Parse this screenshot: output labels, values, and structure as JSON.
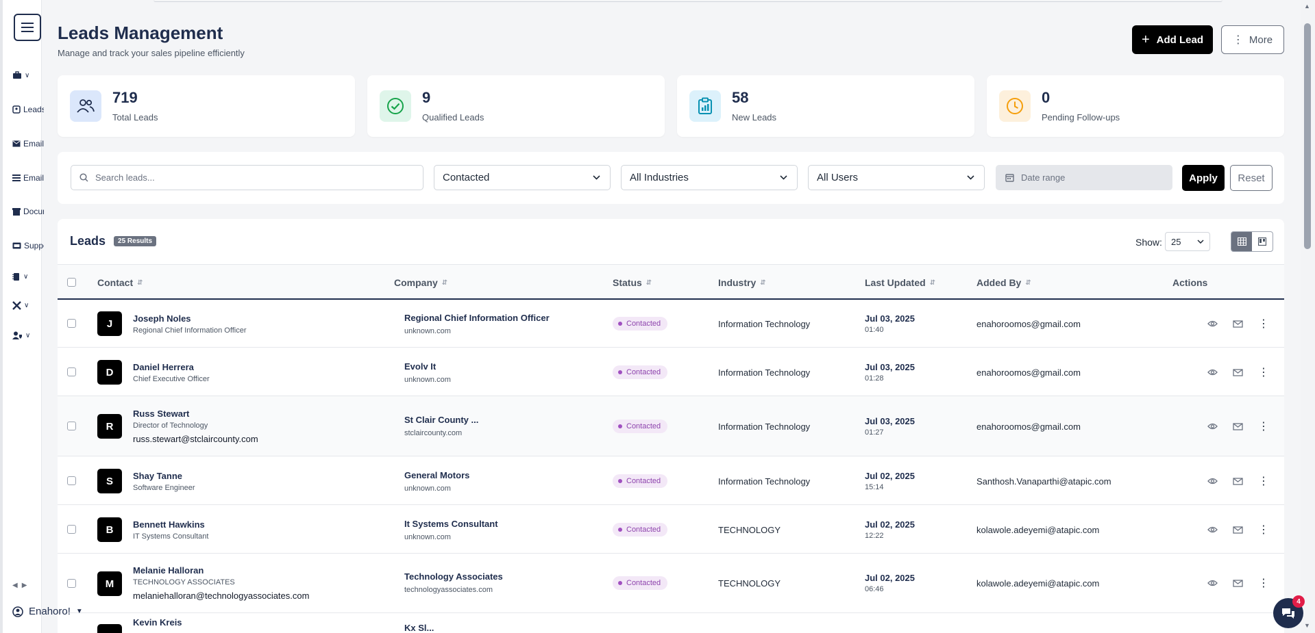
{
  "page": {
    "title": "Leads Management",
    "subtitle": "Manage and track your sales pipeline efficiently",
    "add_lead": "Add Lead",
    "more": "More"
  },
  "sidebar": {
    "items": [
      {
        "label": "",
        "icon": "briefcase-icon"
      },
      {
        "label": "Leads",
        "icon": "contact-card-icon"
      },
      {
        "label": "Email",
        "icon": "envelope-icon"
      },
      {
        "label": "Email",
        "icon": "list-icon"
      },
      {
        "label": "Documents",
        "icon": "archive-icon"
      },
      {
        "label": "Support",
        "icon": "ticket-icon"
      },
      {
        "label": "",
        "icon": "chip-icon"
      },
      {
        "label": "",
        "icon": "tools-icon"
      },
      {
        "label": "",
        "icon": "user-shield-icon"
      }
    ],
    "user": "Enahoro!"
  },
  "stats": [
    {
      "value": "719",
      "label": "Total Leads",
      "icon": "users-icon",
      "bg": "#dbe7fb",
      "fg": "#1f2d4d"
    },
    {
      "value": "9",
      "label": "Qualified Leads",
      "icon": "check-circle-icon",
      "bg": "#dff5ea",
      "fg": "#16a34a"
    },
    {
      "value": "58",
      "label": "New Leads",
      "icon": "clipboard-chart-icon",
      "bg": "#dcf1fb",
      "fg": "#0891b2"
    },
    {
      "value": "0",
      "label": "Pending Follow-ups",
      "icon": "clock-icon",
      "bg": "#fdf0dc",
      "fg": "#f59e0b"
    }
  ],
  "filters": {
    "search_placeholder": "Search leads...",
    "status": "Contacted",
    "industry": "All Industries",
    "users": "All Users",
    "date_placeholder": "Date range",
    "apply": "Apply",
    "reset": "Reset"
  },
  "leads": {
    "title": "Leads",
    "count": "25 Results",
    "show_label": "Show:",
    "page_size": "25",
    "columns": [
      "Contact",
      "Company",
      "Status",
      "Industry",
      "Last Updated",
      "Added By",
      "Actions"
    ],
    "rows": [
      {
        "initial": "J",
        "name": "Joseph Noles",
        "title": "Regional Chief Information Officer",
        "email": "",
        "company": "Regional Chief Information Officer",
        "domain": "unknown.com",
        "status": "Contacted",
        "industry": "Information Technology",
        "date": "Jul 03, 2025",
        "time": "01:40",
        "added_by": "enahoroomos@gmail.com"
      },
      {
        "initial": "D",
        "name": "Daniel Herrera",
        "title": "Chief Executive Officer",
        "email": "",
        "company": "Evolv It",
        "domain": "unknown.com",
        "status": "Contacted",
        "industry": "Information Technology",
        "date": "Jul 03, 2025",
        "time": "01:28",
        "added_by": "enahoroomos@gmail.com"
      },
      {
        "initial": "R",
        "name": "Russ Stewart",
        "title": "Director of Technology",
        "email": "russ.stewart@stclaircounty.com",
        "company": "St Clair County ...",
        "domain": "stclaircounty.com",
        "status": "Contacted",
        "industry": "Information Technology",
        "date": "Jul 03, 2025",
        "time": "01:27",
        "added_by": "enahoroomos@gmail.com"
      },
      {
        "initial": "S",
        "name": "Shay Tanne",
        "title": "Software Engineer",
        "email": "",
        "company": "General Motors",
        "domain": "unknown.com",
        "status": "Contacted",
        "industry": "Information Technology",
        "date": "Jul 02, 2025",
        "time": "15:14",
        "added_by": "Santhosh.Vanaparthi@atapic.com"
      },
      {
        "initial": "B",
        "name": "Bennett Hawkins",
        "title": "IT Systems Consultant",
        "email": "",
        "company": "It Systems Consultant",
        "domain": "unknown.com",
        "status": "Contacted",
        "industry": "TECHNOLOGY",
        "date": "Jul 02, 2025",
        "time": "12:22",
        "added_by": "kolawole.adeyemi@atapic.com"
      },
      {
        "initial": "M",
        "name": "Melanie Halloran",
        "title": "TECHNOLOGY ASSOCIATES",
        "email": "melaniehalloran@technologyassociates.com",
        "company": "Technology Associates",
        "domain": "technologyassociates.com",
        "status": "Contacted",
        "industry": "TECHNOLOGY",
        "date": "Jul 02, 2025",
        "time": "06:46",
        "added_by": "kolawole.adeyemi@atapic.com"
      },
      {
        "initial": "K",
        "name": "Kevin Kreis",
        "title": "",
        "email": "",
        "company": "Kx Sl...",
        "domain": "",
        "status": "",
        "industry": "",
        "date": "",
        "time": "",
        "added_by": ""
      }
    ]
  },
  "chat": {
    "unread": "4"
  }
}
